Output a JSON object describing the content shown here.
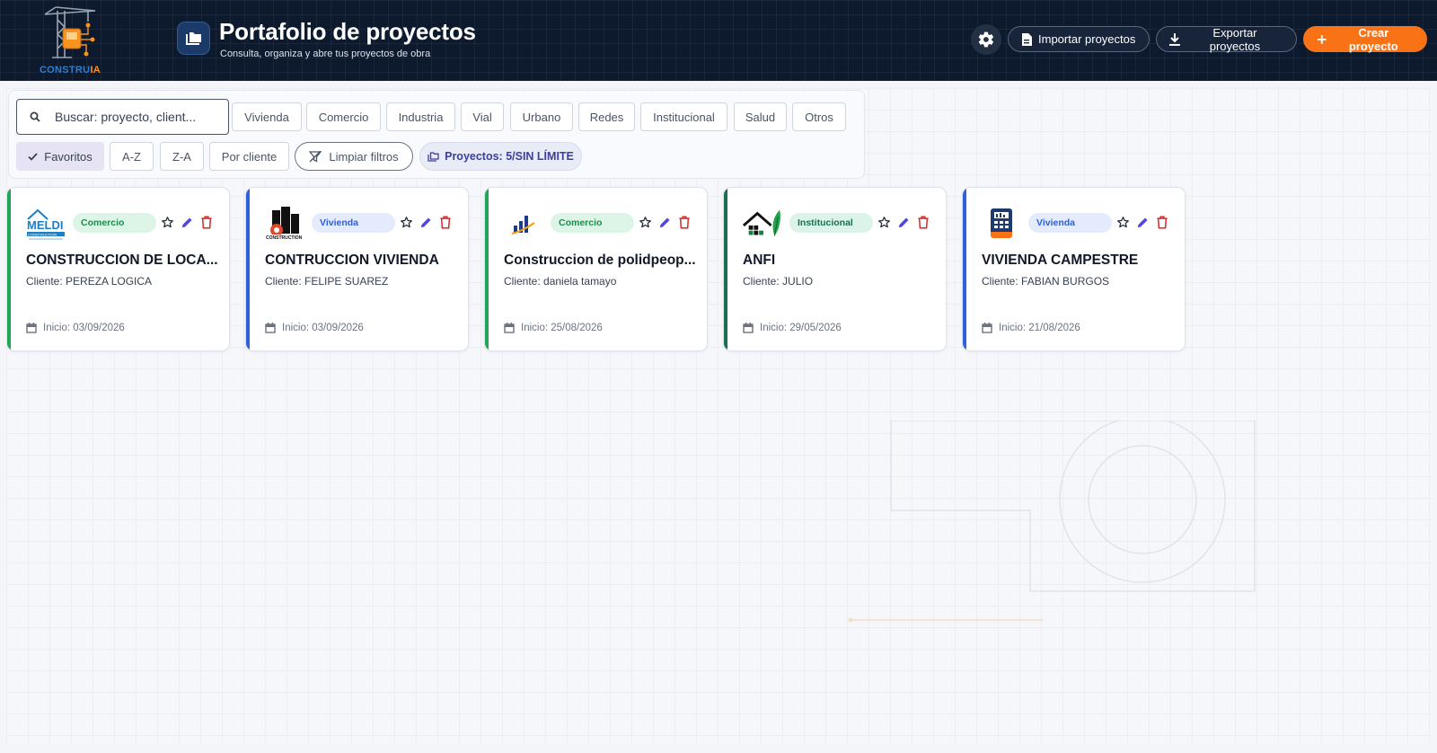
{
  "header": {
    "logo_text": "CONSTRUIA",
    "logo_text_main": "CONSTRU",
    "logo_text_accent": "IA",
    "title": "Portafolio de proyectos",
    "subtitle": "Consulta, organiza y abre tus proyectos de obra",
    "import_label": "Importar proyectos",
    "export_label": "Exportar proyectos",
    "create_label": "Crear proyecto"
  },
  "filters": {
    "search_placeholder": "Buscar: proyecto, client...",
    "categories": [
      "Vivienda",
      "Comercio",
      "Industria",
      "Vial",
      "Urbano",
      "Redes",
      "Institucional",
      "Salud",
      "Otros"
    ],
    "favorites_label": "Favoritos",
    "sort_az": "A-Z",
    "sort_za": "Z-A",
    "by_client": "Por cliente",
    "clear_label": "Limpiar filtros",
    "count_label": "Proyectos: 5/SIN LÍMITE"
  },
  "projects": [
    {
      "name": "CONSTRUCCION DE LOCA...",
      "client": "Cliente: PEREZA LOGICA",
      "start": "Inicio: 03/09/2026",
      "category": "Comercio",
      "stripe_color": "#22a55a",
      "logo": "MELDI",
      "logo_caption": "CONSTRUCTION"
    },
    {
      "name": "CONTRUCCION VIVIENDA",
      "client": "Cliente: FELIPE SUAREZ",
      "start": "Inicio: 03/09/2026",
      "category": "Vivienda",
      "stripe_color": "#2f62d8",
      "logo": "building-gear-logo",
      "logo_caption": "CONSTRUCTION"
    },
    {
      "name": "Construccion de polidpeop...",
      "client": "Cliente: daniela tamayo",
      "start": "Inicio: 25/08/2026",
      "category": "Comercio",
      "stripe_color": "#22a55a",
      "logo": "bar-growth-logo"
    },
    {
      "name": "ANFI",
      "client": "Cliente: JULIO",
      "start": "Inicio: 29/05/2026",
      "category": "Institucional",
      "stripe_color": "#1b6e52",
      "logo": "house-leaf-logo"
    },
    {
      "name": "VIVIENDA CAMPESTRE",
      "client": "Cliente: FABIAN BURGOS",
      "start": "Inicio: 21/08/2026",
      "category": "Vivienda",
      "stripe_color": "#2f62d8",
      "logo": "calculator-logo"
    }
  ],
  "colors": {
    "header_bg": "#0d1a2e",
    "accent_orange": "#f97316",
    "edit_icon": "#4f46e5",
    "delete_icon": "#dc2626"
  }
}
